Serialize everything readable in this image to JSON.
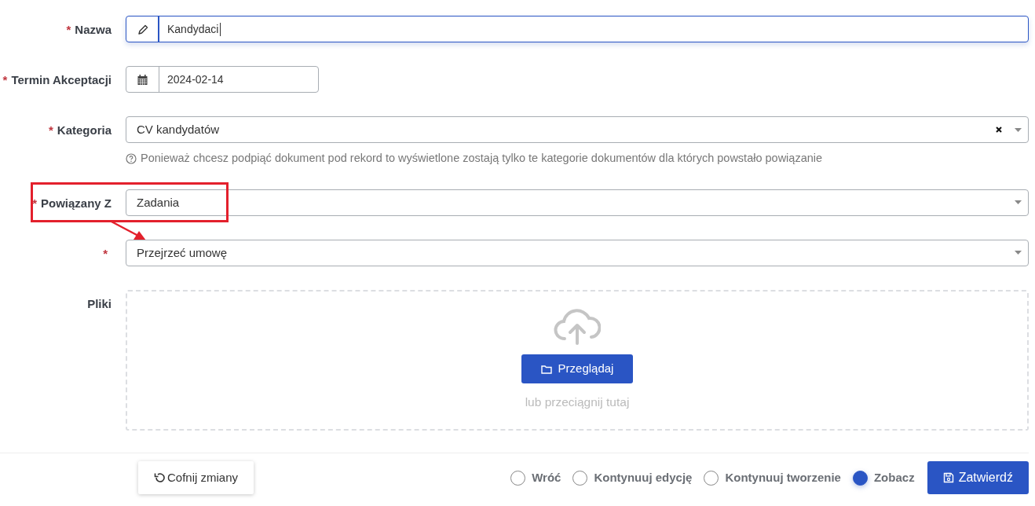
{
  "fields": [
    {
      "kind": "text",
      "mark": "*",
      "label": "Nazwa",
      "value": "Kandydaci",
      "focused": true,
      "highlighted": false
    },
    {
      "kind": "date",
      "mark": "*",
      "label": "Termin Akceptacji",
      "value": "2024-02-14",
      "focused": false,
      "highlighted": false
    },
    {
      "kind": "select",
      "mark": "*",
      "label": "Kategoria",
      "value": "CV kandydatów",
      "clearable": true,
      "help": "Ponieważ chcesz podpiąć dokument pod rekord to wyświetlone zostają tylko te kategorie dokumentów dla których powstało powiązanie",
      "focused": false,
      "highlighted": false
    },
    {
      "kind": "select",
      "mark": "*",
      "label": "Powiązany Z",
      "value": "Zadania",
      "clearable": false,
      "focused": false,
      "highlighted": true
    },
    {
      "kind": "select",
      "mark": "*",
      "value": "Przejrzeć umowę",
      "clearable": false,
      "focused": false,
      "highlighted": false
    },
    {
      "kind": "upload",
      "label": "Pliki",
      "button": "Przeglądaj",
      "hint": "lub przeciągnij tutaj"
    }
  ],
  "footer": {
    "reset_button": "Cofnij zmiany",
    "after_save": [
      {
        "label": "Wróć",
        "selected": false
      },
      {
        "label": "Kontynuuj edycję",
        "selected": false
      },
      {
        "label": "Kontynuuj tworzenie",
        "selected": false
      },
      {
        "label": "Zobacz",
        "selected": true
      }
    ],
    "submit_button": "Zatwierdź"
  }
}
